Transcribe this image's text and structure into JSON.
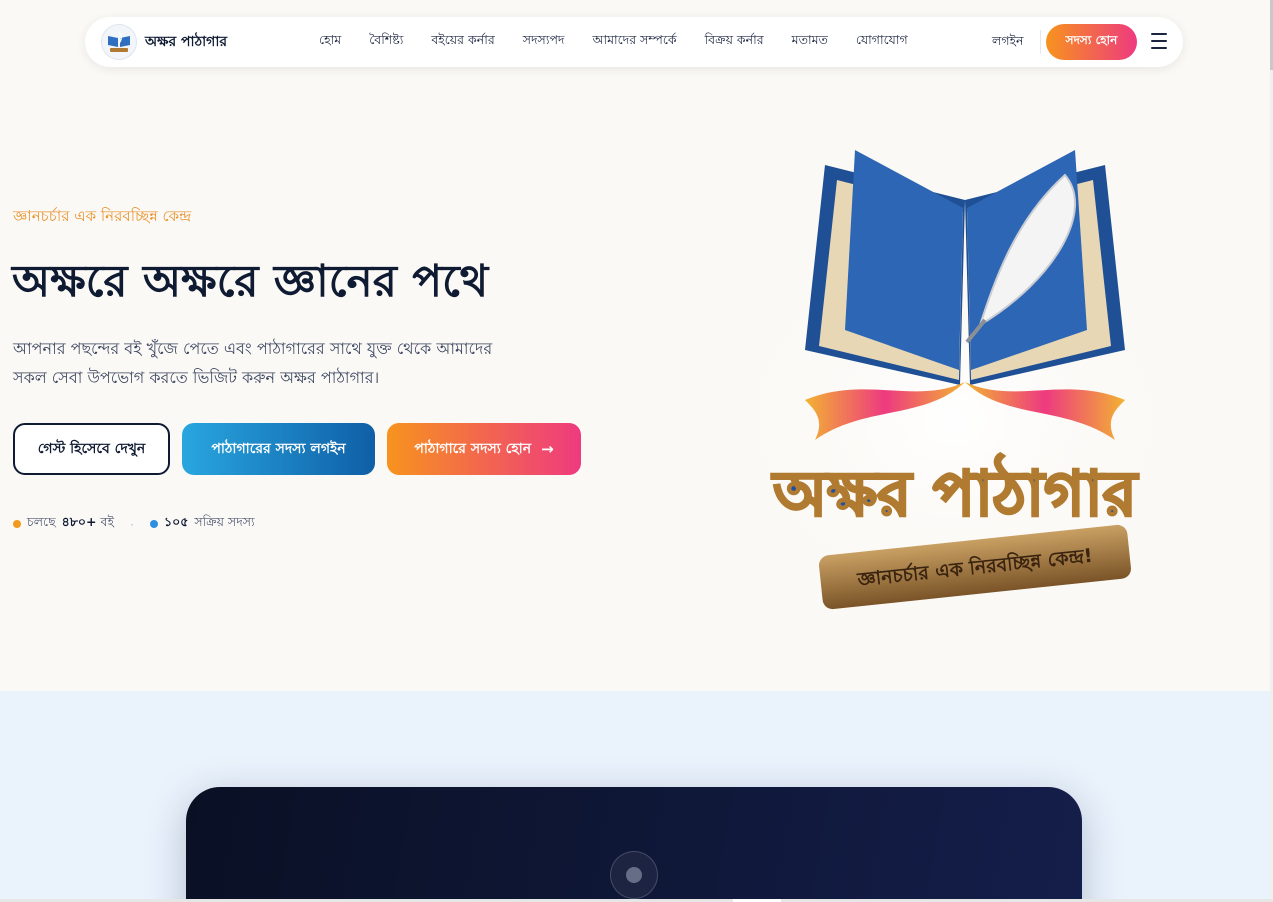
{
  "nav": {
    "brand": "অক্ষর পাঠাগার",
    "links": [
      "হোম",
      "বৈশিষ্ট্য",
      "বইয়ের কর্নার",
      "সদস্যপদ",
      "আমাদের সম্পর্কে",
      "বিক্রয় কর্নার",
      "মতামত",
      "যোগাযোগ"
    ],
    "login": "লগইন",
    "join": "সদস্য হোন",
    "menu_icon": "hamburger-menu-icon"
  },
  "hero": {
    "tagline": "জ্ঞানচর্চার এক নিরবচ্ছিন্ন কেন্দ্র",
    "title": "অক্ষরে অক্ষরে জ্ঞানের পথে",
    "description": "আপনার পছন্দের বই খুঁজে পেতে এবং পাঠাগারের সাথে যুক্ত থেকে আমাদের সকল সেবা উপভোগ করতে ভিজিট করুন অক্ষর পাঠাগার।",
    "buttons": {
      "guest": "গেস্ট হিসেবে দেখুন",
      "member_login": "পাঠাগারের সদস্য লগইন",
      "become_member": "পাঠাগারে সদস্য হোন",
      "arrow_icon": "arrow-right-icon"
    },
    "stats": [
      {
        "prefix": "চলছে",
        "value": "৪৮০+",
        "suffix": "বই"
      },
      {
        "value": "১০৫",
        "suffix": "সক্রিয় সদস্য"
      }
    ],
    "stat_separator": "·",
    "art": {
      "logo_title": "অক্ষর পাঠাগার",
      "logo_banner": "জ্ঞানচর্চার এক নিরবচ্ছিন্ন কেন্দ্র!"
    }
  },
  "colors": {
    "accent_orange": "#f7931e",
    "accent_pink": "#ee3a7f",
    "accent_blue": "#0f5fa6",
    "dark_navy": "#0f1b33"
  }
}
